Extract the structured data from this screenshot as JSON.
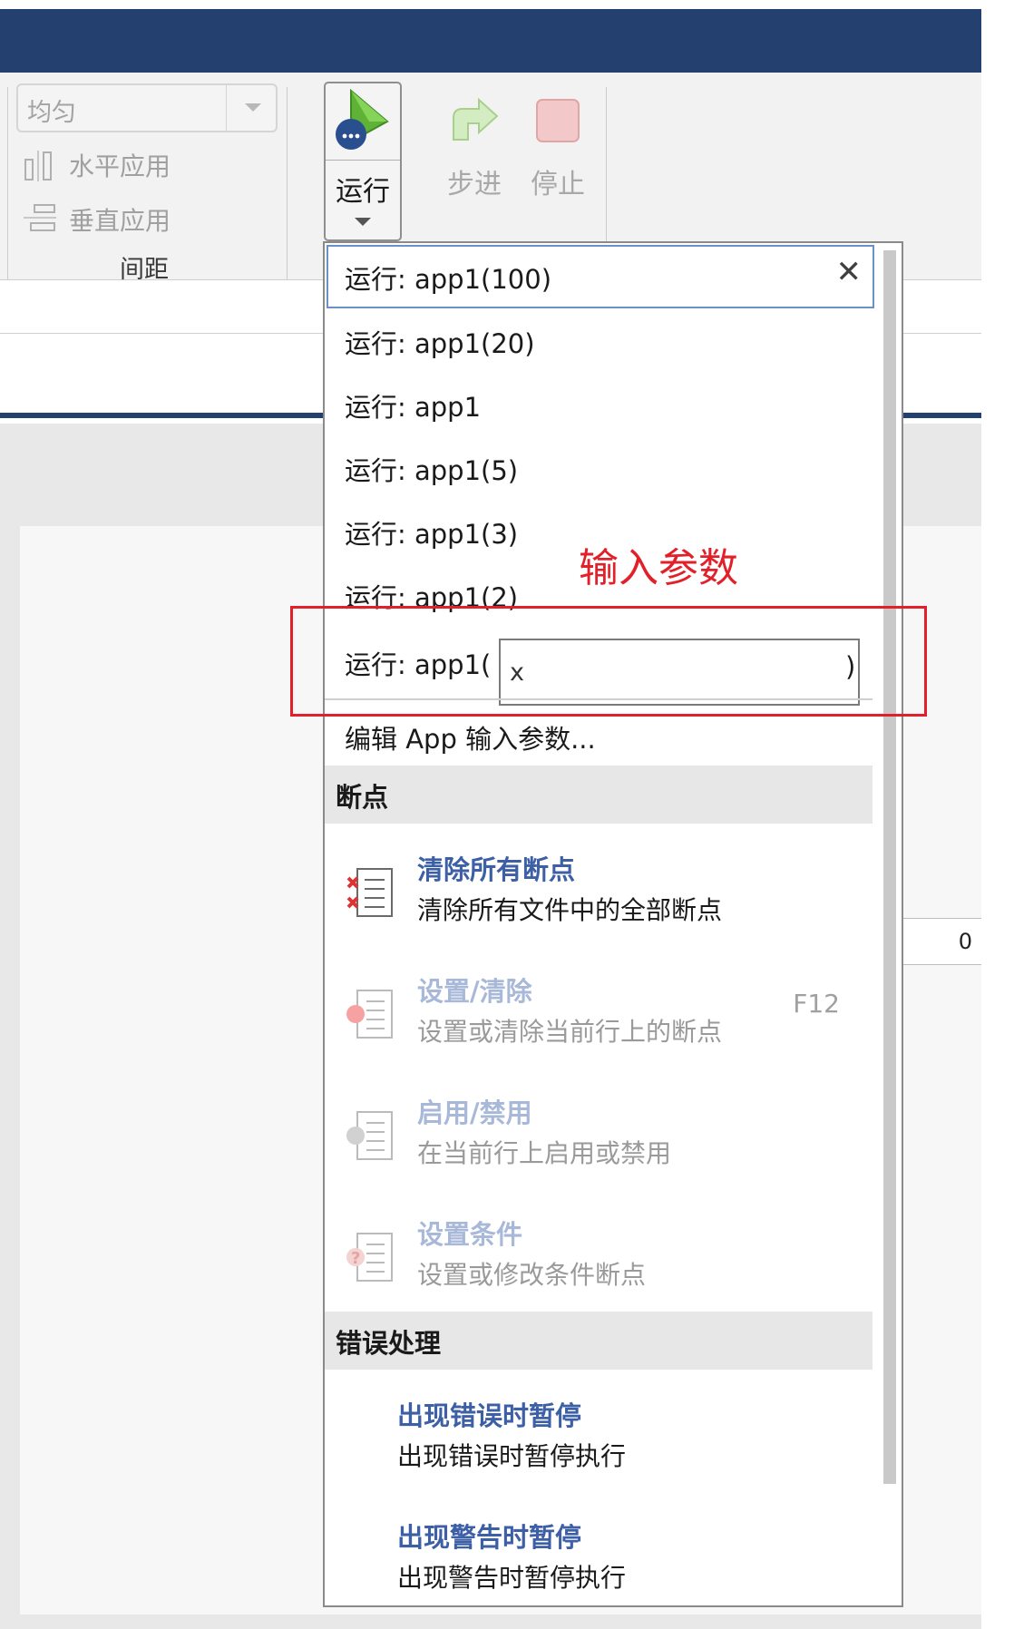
{
  "ribbon": {
    "spacing": {
      "combo_value": "均匀",
      "horizontal_label": "水平应用",
      "vertical_label": "垂直应用",
      "group_label": "间距"
    },
    "run": {
      "run_label": "运行",
      "step_label": "步进",
      "stop_label": "停止"
    }
  },
  "workspace": {
    "right_field_value": "0"
  },
  "menu": {
    "run_items": [
      "运行: app1(100)",
      "运行: app1(20)",
      "运行: app1",
      "运行: app1(5)",
      "运行: app1(3)",
      "运行: app1(2)"
    ],
    "param_prefix": "运行: app1(",
    "param_value": "x",
    "param_suffix": ")",
    "edit_inputs": "编辑 App 输入参数...",
    "breakpoints_header": "断点",
    "breakpoints": [
      {
        "title": "清除所有断点",
        "desc": "清除所有文件中的全部断点",
        "shortcut": "",
        "enabled": true,
        "icon": "clear-breakpoints-icon"
      },
      {
        "title": "设置/清除",
        "desc": "设置或清除当前行上的断点",
        "shortcut": "F12",
        "enabled": false,
        "icon": "set-breakpoint-icon"
      },
      {
        "title": "启用/禁用",
        "desc": "在当前行上启用或禁用",
        "shortcut": "",
        "enabled": false,
        "icon": "toggle-breakpoint-icon"
      },
      {
        "title": "设置条件",
        "desc": "设置或修改条件断点",
        "shortcut": "",
        "enabled": false,
        "icon": "conditional-breakpoint-icon"
      }
    ],
    "errors_header": "错误处理",
    "errors": [
      {
        "title": "出现错误时暂停",
        "desc": "出现错误时暂停执行"
      },
      {
        "title": "出现警告时暂停",
        "desc": "出现警告时暂停执行"
      }
    ]
  },
  "annotation": {
    "text": "输入参数",
    "color": "#e2202a"
  },
  "colors": {
    "title_bar": "#24406e",
    "link_blue": "#3c5fa6",
    "focus_border": "#6b8fc9"
  }
}
